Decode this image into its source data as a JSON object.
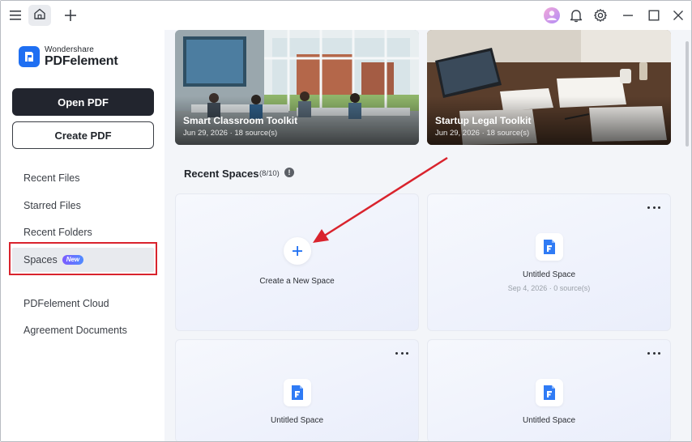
{
  "app": {
    "brand": "Wondershare",
    "product": "PDFelement"
  },
  "titlebar": {
    "icons": [
      "menu-icon",
      "home-icon",
      "plus-icon",
      "avatar",
      "bell-icon",
      "gear-icon",
      "minimize-icon",
      "maximize-icon",
      "close-icon"
    ]
  },
  "sidebar": {
    "open_pdf": "Open PDF",
    "create_pdf": "Create PDF",
    "items": [
      {
        "label": "Recent Files"
      },
      {
        "label": "Starred Files"
      },
      {
        "label": "Recent Folders"
      },
      {
        "label": "Spaces",
        "badge": "New",
        "active": true
      },
      {
        "label": "PDFelement Cloud"
      },
      {
        "label": "Agreement Documents"
      }
    ]
  },
  "toolkits": [
    {
      "title": "Smart Classroom Toolkit",
      "meta": "Jun 29, 2026 · 18 source(s)"
    },
    {
      "title": "Startup Legal Toolkit",
      "meta": "Jun 29, 2026 · 18 source(s)"
    }
  ],
  "recent_spaces": {
    "title": "Recent Spaces",
    "count": "(8/10)",
    "create_label": "Create a New Space",
    "cards": [
      {
        "name": "Untitled Space",
        "meta": "Sep 4, 2026 · 0 source(s)"
      },
      {
        "name": "Untitled Space",
        "meta": ""
      },
      {
        "name": "Untitled Space",
        "meta": ""
      }
    ]
  },
  "colors": {
    "accent": "#1f6ff2",
    "annotation_red": "#d9232d",
    "dark_button": "#22252e"
  }
}
